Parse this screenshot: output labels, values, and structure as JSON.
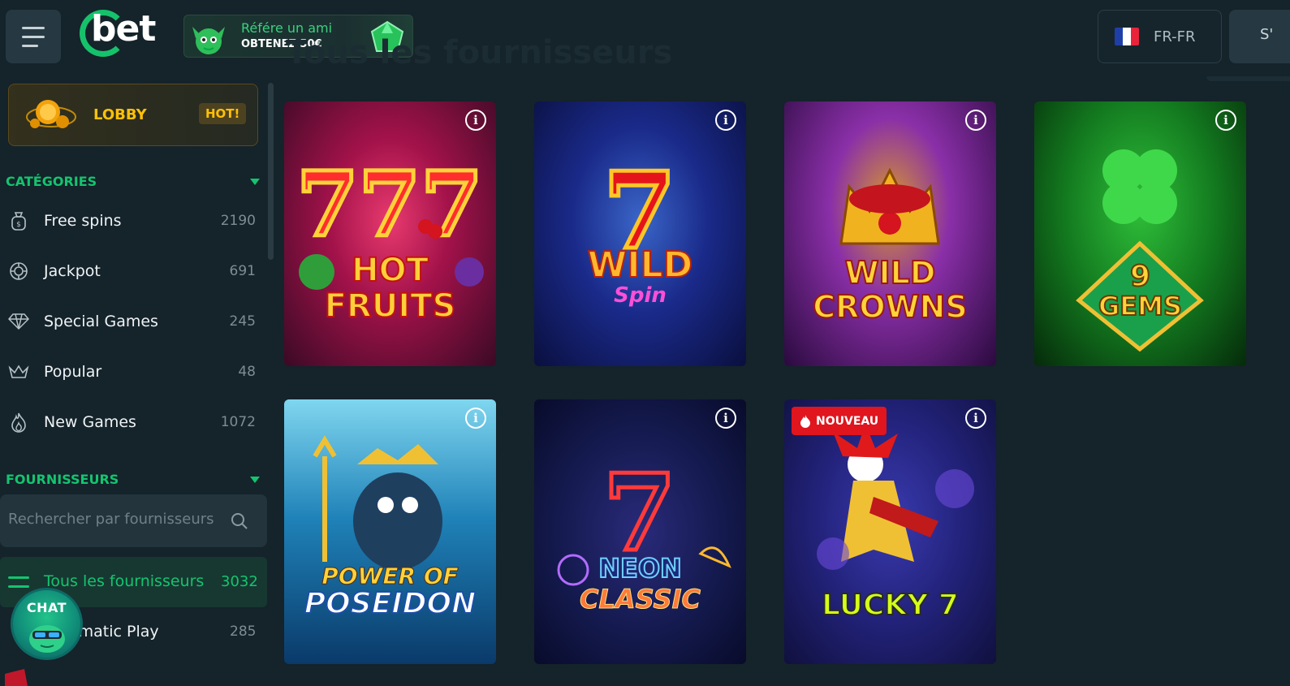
{
  "header": {
    "logo_text": "bet",
    "referral": {
      "line1": "Référe un ami",
      "line2": "OBTENEZ 50€"
    },
    "page_title": "Tous les fournisseurs",
    "language": "FR-FR",
    "signin_label": "S'"
  },
  "sidebar": {
    "lobby": {
      "label": "LOBBY",
      "badge": "HOT!"
    },
    "categories_title": "CATÉGORIES",
    "categories": [
      {
        "label": "Free spins",
        "count": "2190",
        "icon": "money-bag-icon"
      },
      {
        "label": "Jackpot",
        "count": "691",
        "icon": "jackpot-icon"
      },
      {
        "label": "Special Games",
        "count": "245",
        "icon": "diamond-icon"
      },
      {
        "label": "Popular",
        "count": "48",
        "icon": "crown-icon"
      },
      {
        "label": "New Games",
        "count": "1072",
        "icon": "flame-icon"
      }
    ],
    "providers_title": "FOURNISSEURS",
    "provider_search_placeholder": "Rechercher par fournisseurs",
    "providers": [
      {
        "label": "Tous les fournisseurs",
        "count": "3032",
        "active": true
      },
      {
        "label": "Pragmatic Play",
        "count": "285",
        "active": false
      }
    ]
  },
  "chat": {
    "label": "CHAT"
  },
  "games": [
    {
      "title_line1": "HOT",
      "title_line2": "FRUITS",
      "badge": ""
    },
    {
      "title_line1": "WILD",
      "title_line2": "Spin",
      "badge": ""
    },
    {
      "title_line1": "WILD",
      "title_line2": "CROWNS",
      "badge": ""
    },
    {
      "title_line1": "9",
      "title_line2": "GEMS",
      "badge": ""
    },
    {
      "title_line1": "POWER OF",
      "title_line2": "POSEIDON",
      "badge": ""
    },
    {
      "title_line1": "NEON",
      "title_line2": "CLASSIC",
      "badge": ""
    },
    {
      "title_line1": "LUCKY 7",
      "title_line2": "",
      "badge": "NOUVEAU"
    }
  ],
  "colors": {
    "accent": "#14c46f",
    "hot": "#ffc107",
    "badge_red": "#e0151e",
    "background": "#15232a"
  }
}
